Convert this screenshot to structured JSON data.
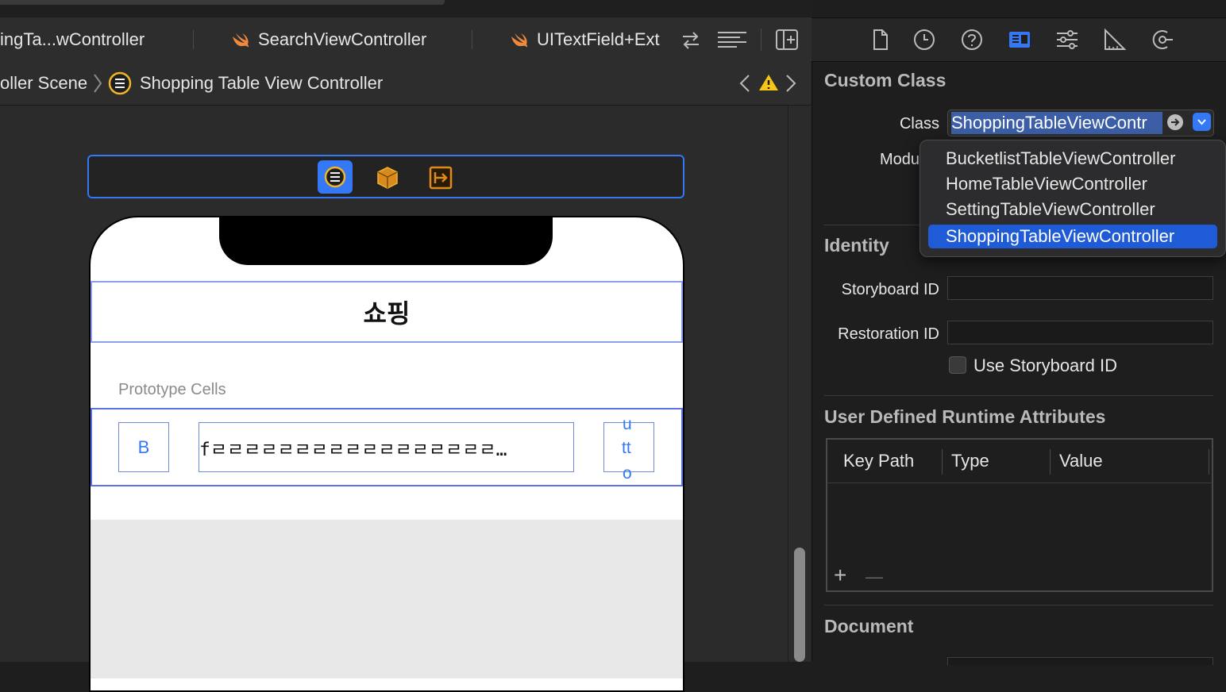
{
  "tabs": [
    {
      "label": "ingTa...wController",
      "icon": "none"
    },
    {
      "label": "SearchViewController",
      "icon": "swift-file-icon"
    },
    {
      "label": "UITextField+Ext",
      "icon": "swift-file-icon"
    }
  ],
  "jumpbar": {
    "scene": "oller Scene",
    "controller": "Shopping Table View Controller"
  },
  "scene": {
    "nav_title": "쇼핑",
    "prototype_label": "Prototype Cells",
    "cell": {
      "button_left": "B",
      "text_field": "fㄹㄹㄹㄹㄹㄹㄹㄹㄹㄹㄹㄹㄹㄹㄹㄹㄹ…",
      "button_right_lines": [
        "u",
        "tt",
        "o"
      ]
    }
  },
  "inspector": {
    "custom_class": {
      "header": "Custom Class",
      "class_label": "Class",
      "class_value": "ShoppingTableViewContr",
      "module_label": "Modu"
    },
    "popup_options": [
      "BucketlistTableViewController",
      "HomeTableViewController",
      "SettingTableViewController",
      "ShoppingTableViewController"
    ],
    "popup_selected_index": 3,
    "identity": {
      "header": "Identity",
      "storyboard_id_label": "Storyboard ID",
      "restoration_id_label": "Restoration ID",
      "use_storyboard_id_label": "Use Storyboard ID"
    },
    "runtime_attributes": {
      "header": "User Defined Runtime Attributes",
      "columns": [
        "Key Path",
        "Type",
        "Value"
      ],
      "add": "+",
      "remove": "—"
    },
    "document": {
      "header": "Document"
    }
  },
  "colors": {
    "accent": "#3478f6",
    "selection": "#1f5bd6",
    "warning": "#f5c518",
    "swift": "#f0883e"
  }
}
